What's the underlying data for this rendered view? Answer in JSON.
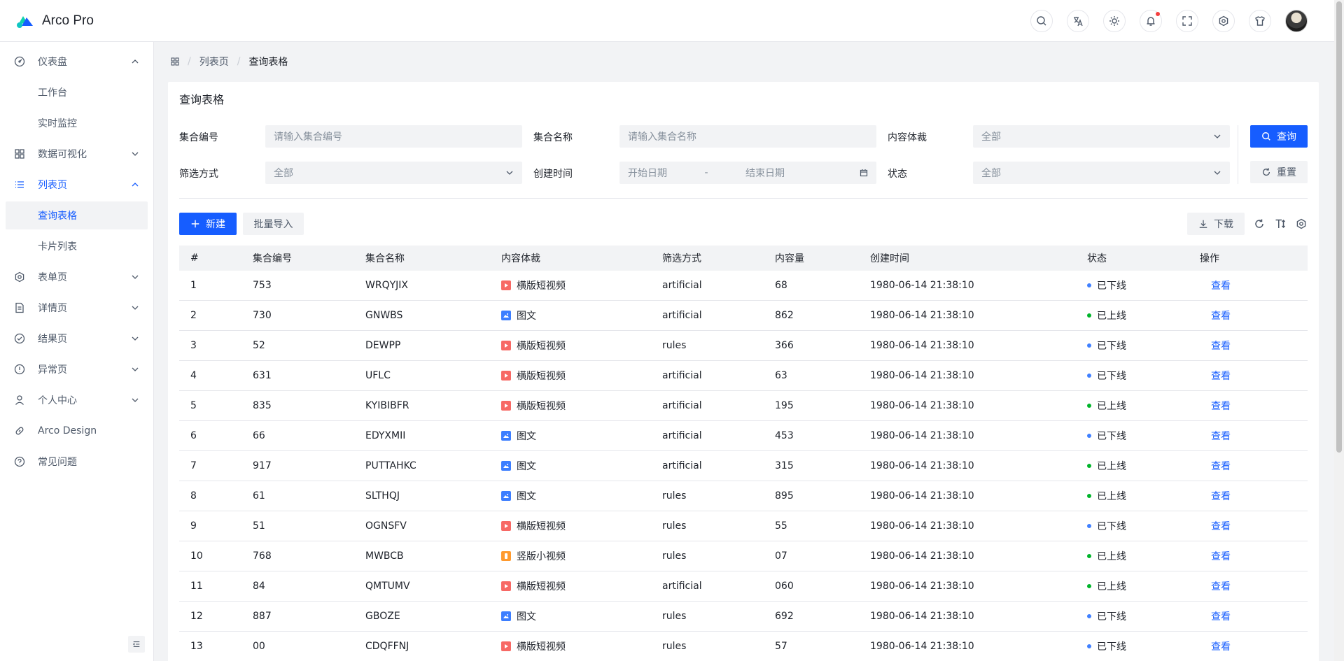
{
  "app": {
    "title": "Arco Pro",
    "brand_colors": [
      "#165dff",
      "#12d2ac",
      "#0fc6c2"
    ]
  },
  "navbar": {
    "icons": [
      "search-icon",
      "language-icon",
      "theme-icon",
      "notification-icon",
      "fullscreen-icon",
      "settings-icon",
      "skin-icon"
    ]
  },
  "sidebar": {
    "items": [
      {
        "label": "仪表盘",
        "icon": "dashboard-icon",
        "expanded": true,
        "sub": false
      },
      {
        "label": "工作台",
        "sub": true
      },
      {
        "label": "实时监控",
        "sub": true
      },
      {
        "label": "数据可视化",
        "icon": "grid-icon",
        "expanded": false,
        "sub": false
      },
      {
        "label": "列表页",
        "icon": "list-icon",
        "expanded": true,
        "sub": false,
        "active_parent": true
      },
      {
        "label": "查询表格",
        "sub": true,
        "active": true
      },
      {
        "label": "卡片列表",
        "sub": true
      },
      {
        "label": "表单页",
        "icon": "settings-icon",
        "expanded": false,
        "sub": false
      },
      {
        "label": "详情页",
        "icon": "file-icon",
        "expanded": false,
        "sub": false
      },
      {
        "label": "结果页",
        "icon": "check-circle-icon",
        "expanded": false,
        "sub": false
      },
      {
        "label": "异常页",
        "icon": "exclamation-circle-icon",
        "expanded": false,
        "sub": false
      },
      {
        "label": "个人中心",
        "icon": "user-icon",
        "expanded": false,
        "sub": false
      },
      {
        "label": "Arco Design",
        "icon": "link-icon",
        "sub": false
      },
      {
        "label": "常见问题",
        "icon": "question-circle-icon",
        "sub": false
      }
    ]
  },
  "breadcrumb": {
    "home_icon": "apps-icon",
    "items": [
      "列表页",
      "查询表格"
    ]
  },
  "card": {
    "title": "查询表格"
  },
  "filters": {
    "id_label": "集合编号",
    "id_placeholder": "请输入集合编号",
    "name_label": "集合名称",
    "name_placeholder": "请输入集合名称",
    "type_label": "内容体裁",
    "type_value": "全部",
    "filter_label": "筛选方式",
    "filter_value": "全部",
    "created_label": "创建时间",
    "start_placeholder": "开始日期",
    "date_separator": "-",
    "end_placeholder": "结束日期",
    "status_label": "状态",
    "status_value": "全部",
    "search_button": "查询",
    "reset_button": "重置"
  },
  "toolbar": {
    "new_button": "新建",
    "import_button": "批量导入",
    "download_button": "下载"
  },
  "table": {
    "headers": [
      "#",
      "集合编号",
      "集合名称",
      "内容体裁",
      "筛选方式",
      "内容量",
      "创建时间",
      "状态",
      "操作"
    ],
    "rows": [
      {
        "idx": "1",
        "id": "753",
        "name": "WRQYJIX",
        "type": "横版短视频",
        "type_kind": "video",
        "filter": "artificial",
        "count": "68",
        "created": "1980-06-14 21:38:10",
        "status": "已下线",
        "status_kind": "offline",
        "action": "查看"
      },
      {
        "idx": "2",
        "id": "730",
        "name": "GNWBS",
        "type": "图文",
        "type_kind": "image",
        "filter": "artificial",
        "count": "862",
        "created": "1980-06-14 21:38:10",
        "status": "已上线",
        "status_kind": "online",
        "action": "查看"
      },
      {
        "idx": "3",
        "id": "52",
        "name": "DEWPP",
        "type": "横版短视频",
        "type_kind": "video",
        "filter": "rules",
        "count": "366",
        "created": "1980-06-14 21:38:10",
        "status": "已下线",
        "status_kind": "offline",
        "action": "查看"
      },
      {
        "idx": "4",
        "id": "631",
        "name": "UFLC",
        "type": "横版短视频",
        "type_kind": "video",
        "filter": "artificial",
        "count": "63",
        "created": "1980-06-14 21:38:10",
        "status": "已下线",
        "status_kind": "offline",
        "action": "查看"
      },
      {
        "idx": "5",
        "id": "835",
        "name": "KYIBIBFR",
        "type": "横版短视频",
        "type_kind": "video",
        "filter": "artificial",
        "count": "195",
        "created": "1980-06-14 21:38:10",
        "status": "已上线",
        "status_kind": "online",
        "action": "查看"
      },
      {
        "idx": "6",
        "id": "66",
        "name": "EDYXMII",
        "type": "图文",
        "type_kind": "image",
        "filter": "artificial",
        "count": "453",
        "created": "1980-06-14 21:38:10",
        "status": "已下线",
        "status_kind": "offline",
        "action": "查看"
      },
      {
        "idx": "7",
        "id": "917",
        "name": "PUTTAHKC",
        "type": "图文",
        "type_kind": "image",
        "filter": "artificial",
        "count": "315",
        "created": "1980-06-14 21:38:10",
        "status": "已上线",
        "status_kind": "online",
        "action": "查看"
      },
      {
        "idx": "8",
        "id": "61",
        "name": "SLTHQJ",
        "type": "图文",
        "type_kind": "image",
        "filter": "rules",
        "count": "895",
        "created": "1980-06-14 21:38:10",
        "status": "已上线",
        "status_kind": "online",
        "action": "查看"
      },
      {
        "idx": "9",
        "id": "51",
        "name": "OGNSFV",
        "type": "横版短视频",
        "type_kind": "video",
        "filter": "rules",
        "count": "55",
        "created": "1980-06-14 21:38:10",
        "status": "已下线",
        "status_kind": "offline",
        "action": "查看"
      },
      {
        "idx": "10",
        "id": "768",
        "name": "MWBCB",
        "type": "竖版小视频",
        "type_kind": "vertical",
        "filter": "rules",
        "count": "07",
        "created": "1980-06-14 21:38:10",
        "status": "已上线",
        "status_kind": "online",
        "action": "查看"
      },
      {
        "idx": "11",
        "id": "84",
        "name": "QMTUMV",
        "type": "横版短视频",
        "type_kind": "video",
        "filter": "artificial",
        "count": "060",
        "created": "1980-06-14 21:38:10",
        "status": "已上线",
        "status_kind": "online",
        "action": "查看"
      },
      {
        "idx": "12",
        "id": "887",
        "name": "GBOZE",
        "type": "图文",
        "type_kind": "image",
        "filter": "rules",
        "count": "692",
        "created": "1980-06-14 21:38:10",
        "status": "已下线",
        "status_kind": "offline",
        "action": "查看"
      },
      {
        "idx": "13",
        "id": "00",
        "name": "CDQFFNJ",
        "type": "横版短视频",
        "type_kind": "video",
        "filter": "rules",
        "count": "57",
        "created": "1980-06-14 21:38:10",
        "status": "已下线",
        "status_kind": "offline",
        "action": "查看"
      }
    ]
  },
  "colors": {
    "primary": "#165dff",
    "video": "#f76965",
    "image": "#3c7eff",
    "vertical": "#ff9a2e",
    "online": "#00b42a",
    "offline": "#4080ff"
  }
}
